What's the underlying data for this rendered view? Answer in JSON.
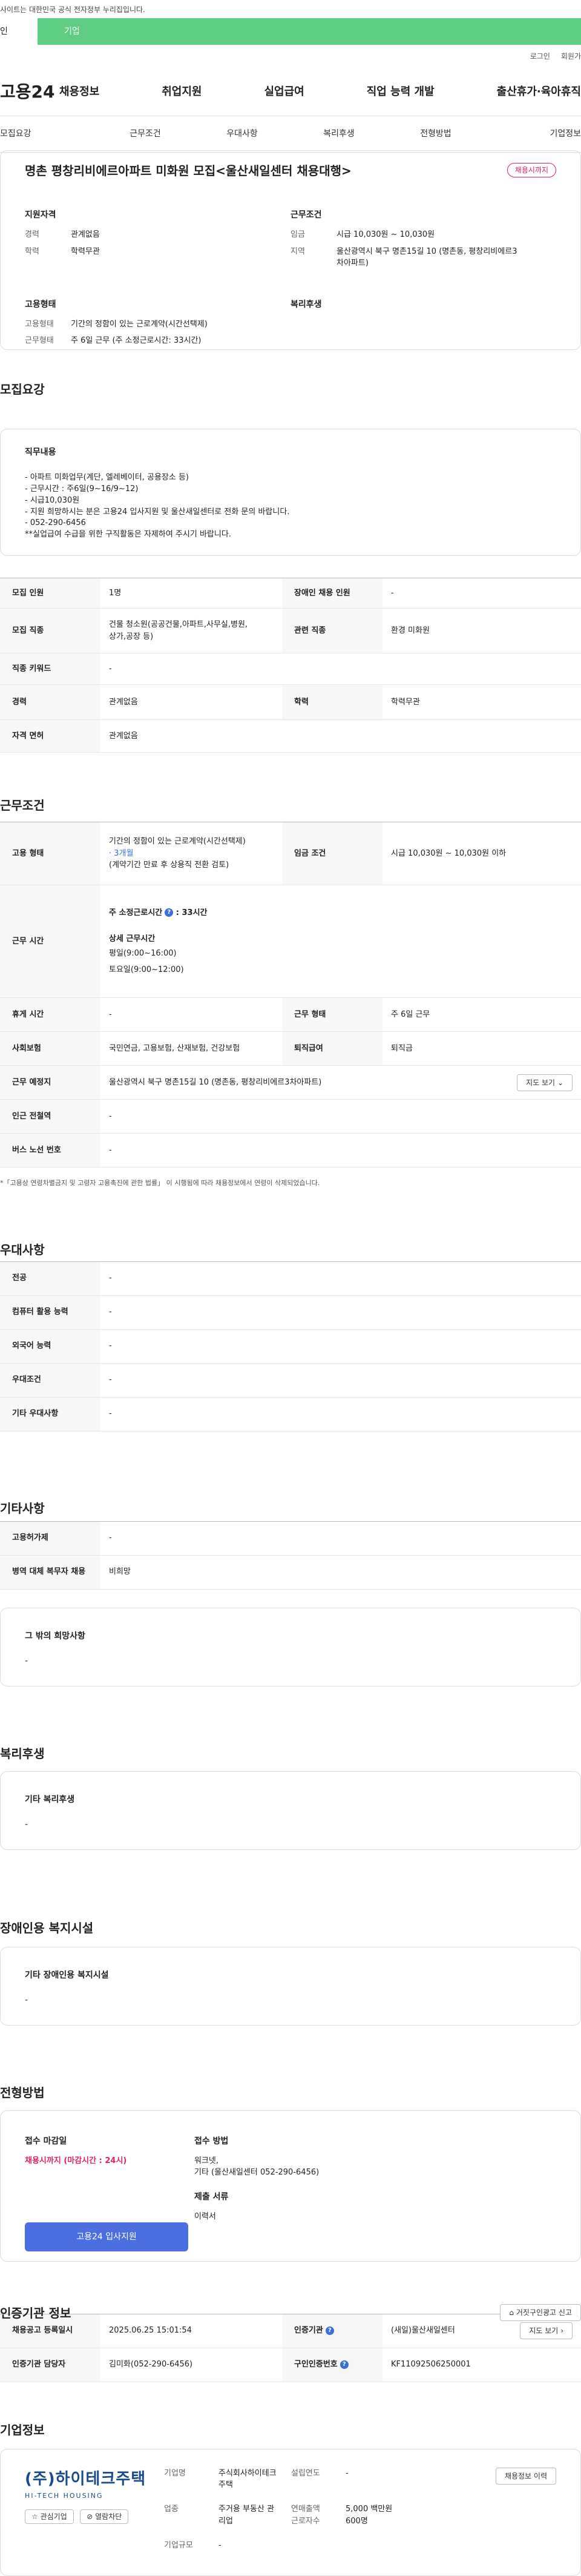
{
  "gov_notice": "사이트는 대한민국 공식 전자정부 누리집입니다.",
  "user_tabs": [
    "인",
    "기업"
  ],
  "util": [
    "로그인",
    "회원가"
  ],
  "logo": "고용24",
  "gnb": [
    "채용정보",
    "취업지원",
    "실업급여",
    "직업 능력 개발",
    "출산휴가·육아휴직"
  ],
  "subtabs": [
    "모집요강",
    "근무조건",
    "우대사항",
    "복리후생",
    "전형방법",
    "기업정보"
  ],
  "summary": {
    "title": "명촌 평창리비에르아파트 미화원 모집<울산새일센터 채용대행>",
    "badge": "채용시까지",
    "qual_title": "지원자격",
    "career_k": "경력",
    "career_v": "관계없음",
    "edu_k": "학력",
    "edu_v": "학력무관",
    "cond_title": "근무조건",
    "wage_k": "임금",
    "wage_v": "시급 10,030원 ~ 10,030원",
    "area_k": "지역",
    "area_v": "울산광역시 북구 명촌15길 10 (명촌동, 평창리비에르3차아파트)",
    "type_title": "고용형태",
    "etype_k": "고용형태",
    "etype_v": "기간의 정함이 있는 근로계약(시간선택제)",
    "wtype_k": "근무형태",
    "wtype_v": "주 6일 근무 (주 소정근로시간: 33시간)",
    "welfare_title": "복리후생"
  },
  "recruit": {
    "title": "모집요강",
    "duty_title": "직무내용",
    "duty_lines": [
      "- 아파트 미화업무(계단, 엘레베이터, 공용장소 등)",
      "- 근무시간 : 주6일(9~16/9~12)",
      "- 시급10,030원",
      "- 지원 희망하시는 분은 고용24 입사지원 및 울산새일센터로 전화 문의 바랍니다.",
      "- 052-290-6456",
      "**실업급여 수급을 위한 구직활동은 자제하여 주시기 바랍니다."
    ],
    "rows": {
      "count_k": "모집 인원",
      "count_v": "1명",
      "disabled_k": "장애인 채용 인원",
      "disabled_v": "-",
      "job_k": "모집 직종",
      "job_v1": "건물 청소원(공공건물,아파트,사무실,병원,",
      "job_v2": "상가,공장 등)",
      "rel_k": "관련 직종",
      "rel_v": "환경 미화원",
      "kw_k": "직종 키워드",
      "kw_v": "-",
      "career_k": "경력",
      "career_v": "관계없음",
      "edu_k": "학력",
      "edu_v": "학력무관",
      "lic_k": "자격 면허",
      "lic_v": "관계없음"
    }
  },
  "work": {
    "title": "근무조건",
    "etype_k": "고용 형태",
    "etype_v1": "기간의 정함이 있는 근로계약(시간선택제)",
    "etype_v2": "· 3개월",
    "etype_v3": "(계약기간 만료 후 상용직 전환 검토)",
    "wage_k": "임금 조건",
    "wage_v": "시급 10,030원 ~ 10,030원 이하",
    "hours_k": "근무 시간",
    "hours_total": "주 소정근로시간",
    "hours_total_v": ": 33시간",
    "hours_detail": "상세 근무시간",
    "hours_weekday": "평일(9:00~16:00)",
    "hours_sat": "토요일(9:00~12:00)",
    "break_k": "휴게 시간",
    "break_v": "-",
    "wtype_k": "근무 형태",
    "wtype_v": "주 6일 근무",
    "ins_k": "사회보험",
    "ins_v": "국민연금, 고용보험, 산재보험, 건강보험",
    "ret_k": "퇴직급여",
    "ret_v": "퇴직금",
    "place_k": "근무 예정지",
    "place_v": "울산광역시 북구 명촌15길 10 (명촌동, 평창리비에르3차아파트)",
    "map_btn": "지도 보기",
    "sub_k": "인근 전철역",
    "sub_v": "-",
    "bus_k": "버스 노선 번호",
    "bus_v": "-",
    "note": "*「고용상 연령차별금지 및 고령자 고용촉진에 관한 법률」 이 시행됨에 따라 채용정보에서 연령이 삭제되었습니다."
  },
  "pref": {
    "title": "우대사항",
    "rows": [
      {
        "k": "전공",
        "v": "-"
      },
      {
        "k": "컴퓨터 활용 능력",
        "v": "-"
      },
      {
        "k": "외국어 능력",
        "v": "-"
      },
      {
        "k": "우대조건",
        "v": "-"
      },
      {
        "k": "기타 우대사항",
        "v": "-"
      }
    ]
  },
  "etc": {
    "title": "기타사항",
    "rows": [
      {
        "k": "고용허가제",
        "v": "-"
      },
      {
        "k": "병역 대체 복무자 채용",
        "v": "비희망"
      }
    ],
    "box_title": "그 밖의 희망사항",
    "box_v": "-"
  },
  "welfare": {
    "title": "복리후생",
    "box_title": "기타 복리후생",
    "box_v": "-"
  },
  "disabled": {
    "title": "장애인용 복지시설",
    "box_title": "기타 장애인용 복지시설",
    "box_v": "-"
  },
  "process": {
    "title": "전형방법",
    "deadline_title": "접수 마감일",
    "deadline_v": "채용시까지 (마감시간 : 24시)",
    "method_title": "접수 방법",
    "method_v1": "워크넷,",
    "method_v2": "기타 (울산새일센터 052-290-6456)",
    "doc_title": "제출 서류",
    "doc_v": "이력서",
    "apply_btn": "고용24 입사지원"
  },
  "agency": {
    "title": "인증기관 정보",
    "report_btn": "거짓구인광고 신고",
    "reg_k": "채용공고 등록일시",
    "reg_v": "2025.06.25 15:01:54",
    "org_k": "인증기관",
    "org_v": "(새일)울산새일센터",
    "map_btn": "지도 보기",
    "mgr_k": "인증기관 담당자",
    "mgr_v": "김미화(052-290-6456)",
    "no_k": "구인인증번호",
    "no_v": "KF11092506250001"
  },
  "company": {
    "title": "기업정보",
    "logo_main": "(주)하이테크주택",
    "logo_sub": "HI-TECH HOUSING",
    "fav": "관심기업",
    "block": "열람차단",
    "name_k": "기업명",
    "name_v1": "주식회사하이테크",
    "name_v2": "주택",
    "ind_k": "업종",
    "ind_v1": "주거용 부동산 관",
    "ind_v2": "리업",
    "size_k": "기업규모",
    "size_v": "-",
    "est_k": "설립연도",
    "est_v": "-",
    "sales_k": "연매출액",
    "sales_v": "5,000 백만원",
    "emp_k": "근로자수",
    "emp_v": "600명",
    "history_btn": "채용정보 이력"
  }
}
